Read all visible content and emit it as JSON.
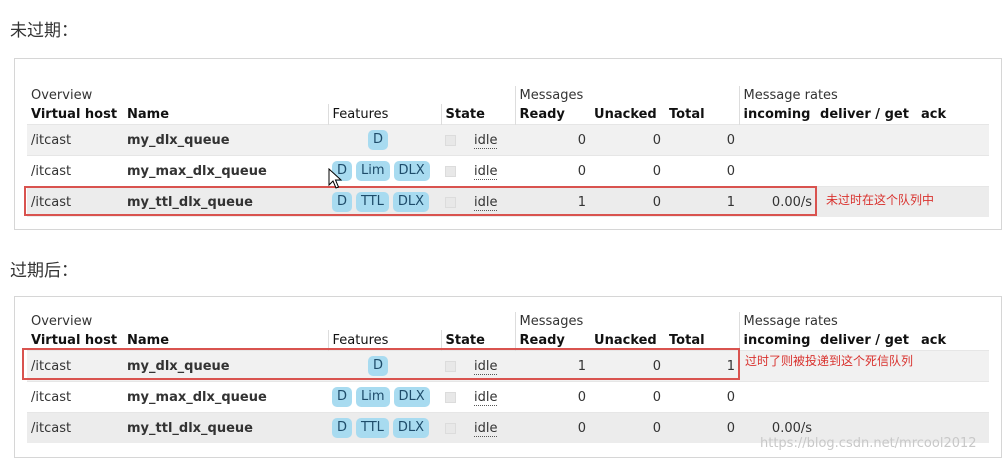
{
  "sections": {
    "before": {
      "heading": "未过期：",
      "note": "未过时在这个队列中",
      "rows": [
        {
          "vhost": "/itcast",
          "name": "my_dlx_queue",
          "features": [
            "D"
          ],
          "state": "idle",
          "ready": "0",
          "unacked": "0",
          "total": "0",
          "incoming": "",
          "deliver": "",
          "ack": ""
        },
        {
          "vhost": "/itcast",
          "name": "my_max_dlx_queue",
          "features": [
            "D",
            "Lim",
            "DLX"
          ],
          "state": "idle",
          "ready": "0",
          "unacked": "0",
          "total": "0",
          "incoming": "",
          "deliver": "",
          "ack": ""
        },
        {
          "vhost": "/itcast",
          "name": "my_ttl_dlx_queue",
          "features": [
            "D",
            "TTL",
            "DLX"
          ],
          "state": "idle",
          "ready": "1",
          "unacked": "0",
          "total": "1",
          "incoming": "0.00/s",
          "deliver": "",
          "ack": ""
        }
      ]
    },
    "after": {
      "heading": "过期后：",
      "note": "过时了则被投递到这个死信队列",
      "rows": [
        {
          "vhost": "/itcast",
          "name": "my_dlx_queue",
          "features": [
            "D"
          ],
          "state": "idle",
          "ready": "1",
          "unacked": "0",
          "total": "1",
          "incoming": "",
          "deliver": "",
          "ack": ""
        },
        {
          "vhost": "/itcast",
          "name": "my_max_dlx_queue",
          "features": [
            "D",
            "Lim",
            "DLX"
          ],
          "state": "idle",
          "ready": "0",
          "unacked": "0",
          "total": "0",
          "incoming": "",
          "deliver": "",
          "ack": ""
        },
        {
          "vhost": "/itcast",
          "name": "my_ttl_dlx_queue",
          "features": [
            "D",
            "TTL",
            "DLX"
          ],
          "state": "idle",
          "ready": "0",
          "unacked": "0",
          "total": "0",
          "incoming": "0.00/s",
          "deliver": "",
          "ack": ""
        }
      ]
    }
  },
  "table": {
    "group_overview": "Overview",
    "group_messages": "Messages",
    "group_rates": "Message rates",
    "col_vhost": "Virtual host",
    "col_name": "Name",
    "col_features": "Features",
    "col_state": "State",
    "col_ready": "Ready",
    "col_unacked": "Unacked",
    "col_total": "Total",
    "col_incoming": "incoming",
    "col_deliver": "deliver / get",
    "col_ack": "ack"
  },
  "watermark": "https://blog.csdn.net/mrcool2012",
  "colors": {
    "badge": "#a8dbf0",
    "highlight": "#d9534f",
    "note": "#d9322e"
  }
}
